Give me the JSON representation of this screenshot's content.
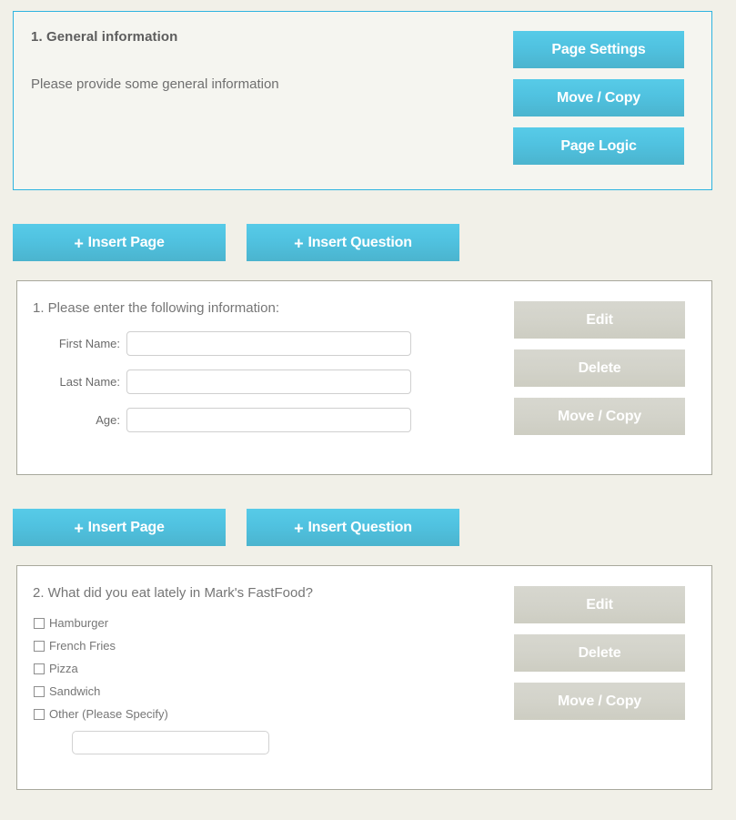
{
  "page_block": {
    "title": "1. General information",
    "description": "Please provide some general information",
    "buttons": [
      {
        "label": "Page Settings",
        "name": "page-settings-button"
      },
      {
        "label": "Move / Copy",
        "name": "move-copy-page-button"
      },
      {
        "label": "Page Logic",
        "name": "page-logic-button"
      }
    ]
  },
  "insert_bar": {
    "plus": "+",
    "insert_page_label": "Insert Page",
    "insert_question_label": "Insert Question"
  },
  "questions": [
    {
      "title": "1. Please enter the following information:",
      "type": "text-fields",
      "fields": [
        {
          "label": "First Name:",
          "value": "",
          "placeholder": ""
        },
        {
          "label": "Last Name:",
          "value": "",
          "placeholder": ""
        },
        {
          "label": "Age:",
          "value": "",
          "placeholder": ""
        }
      ],
      "actions": [
        {
          "label": "Edit",
          "name": "edit-button"
        },
        {
          "label": "Delete",
          "name": "delete-button"
        },
        {
          "label": "Move / Copy",
          "name": "move-copy-button"
        }
      ]
    },
    {
      "title": "2. What did you eat lately in Mark's FastFood?",
      "type": "checkbox-list",
      "choices": [
        {
          "label": "Hamburger",
          "checked": false
        },
        {
          "label": "French Fries",
          "checked": false
        },
        {
          "label": "Pizza",
          "checked": false
        },
        {
          "label": "Sandwich",
          "checked": false
        },
        {
          "label": "Other (Please Specify)",
          "checked": false
        }
      ],
      "other_value": "",
      "other_placeholder": "",
      "actions": [
        {
          "label": "Edit",
          "name": "edit-button"
        },
        {
          "label": "Delete",
          "name": "delete-button"
        },
        {
          "label": "Move / Copy",
          "name": "move-copy-button"
        }
      ]
    }
  ],
  "colors": {
    "accent_blue": "#4fc3e0",
    "panel_border_blue": "#2eb3e0",
    "gray_button": "#d3d3ca",
    "page_background": "#f1f0e8",
    "panel_background": "#f5f5f0",
    "text_gray": "#767676"
  }
}
